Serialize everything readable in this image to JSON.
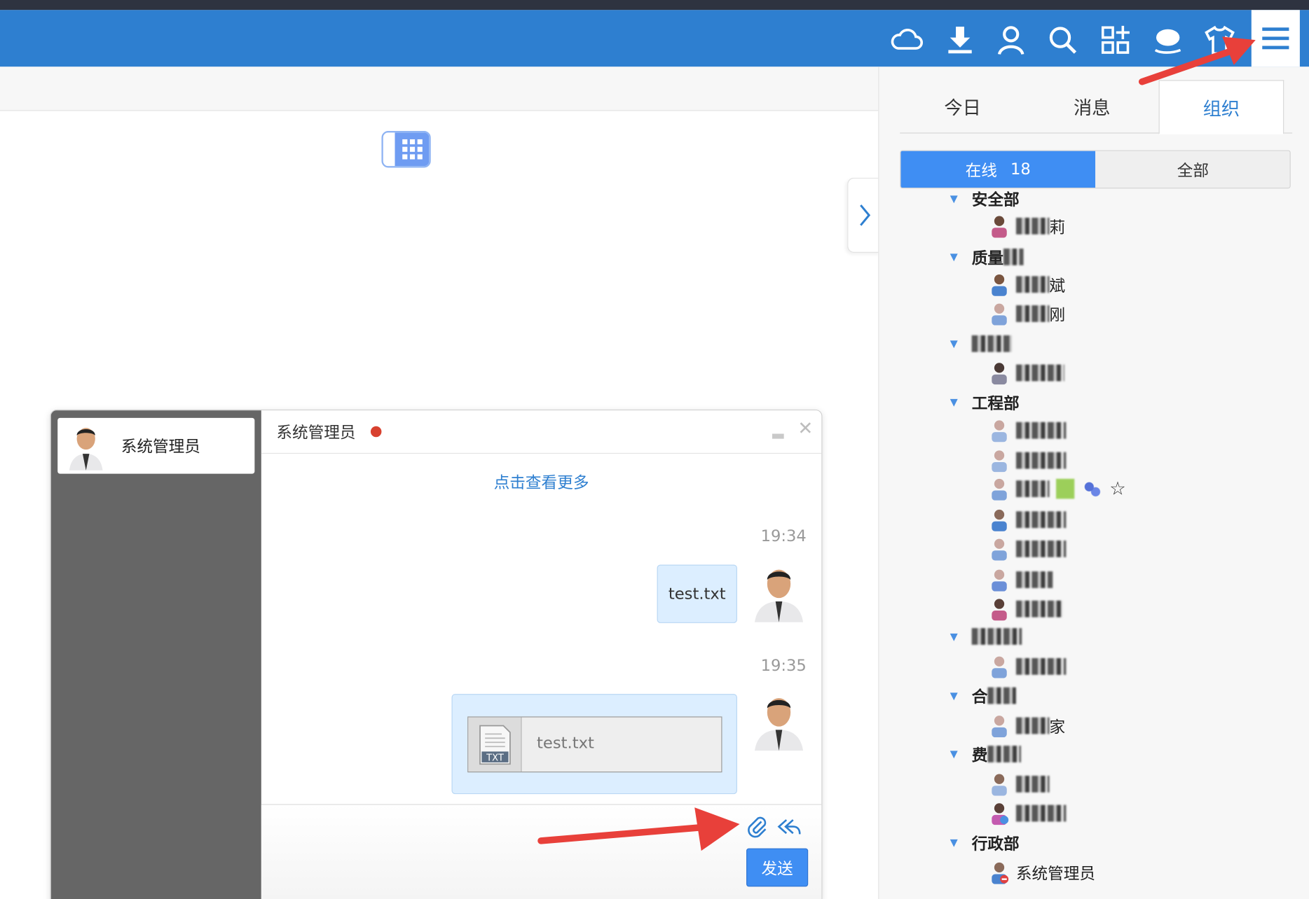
{
  "topbar": {
    "icons": [
      "cloud-icon",
      "download-icon",
      "user-icon",
      "search-icon",
      "apps-icon",
      "chat-bubble-icon",
      "tshirt-icon",
      "menu-icon"
    ]
  },
  "panel": {
    "tabs": [
      {
        "label": "今日",
        "active": false
      },
      {
        "label": "消息",
        "active": false
      },
      {
        "label": "组织",
        "active": true
      }
    ],
    "segment": {
      "online_label": "在线",
      "online_count": "18",
      "all_label": "全部"
    },
    "departments": [
      {
        "name": "安全部",
        "members": [
          {
            "name_suffix": "莉"
          }
        ]
      },
      {
        "name": "质量",
        "members": [
          {
            "name_suffix": "斌"
          },
          {
            "name_suffix": "刚"
          }
        ]
      },
      {
        "name": "",
        "members": [
          {
            "name_suffix": ""
          }
        ]
      },
      {
        "name": "工程部",
        "members": [
          {
            "name_suffix": ""
          },
          {
            "name_suffix": ""
          },
          {
            "name_suffix": ""
          },
          {
            "name_suffix": ""
          },
          {
            "name_suffix": ""
          },
          {
            "name_suffix": ""
          },
          {
            "name_suffix": ""
          }
        ]
      },
      {
        "name": "",
        "members": [
          {
            "name_suffix": ""
          }
        ]
      },
      {
        "name": "合",
        "members": [
          {
            "name_suffix": "家"
          }
        ]
      },
      {
        "name": "费",
        "members": [
          {
            "name_suffix": ""
          },
          {
            "name_suffix": ""
          }
        ]
      },
      {
        "name": "行政部",
        "members": [
          {
            "name_suffix": "系统管理员"
          }
        ]
      }
    ]
  },
  "chat": {
    "contact_name": "系统管理员",
    "header_title": "系统管理员",
    "load_more": "点击查看更多",
    "messages": [
      {
        "time": "19:34",
        "text": "test.txt",
        "type": "text"
      },
      {
        "time": "19:35",
        "file_name": "test.txt",
        "file_badge": "TXT",
        "type": "file"
      }
    ],
    "send_label": "发送"
  },
  "colors": {
    "topbar": "#2e7fd0",
    "accent": "#3f8ef3",
    "annotation_arrow": "#e8403a",
    "presence_dot": "#d8412f"
  }
}
